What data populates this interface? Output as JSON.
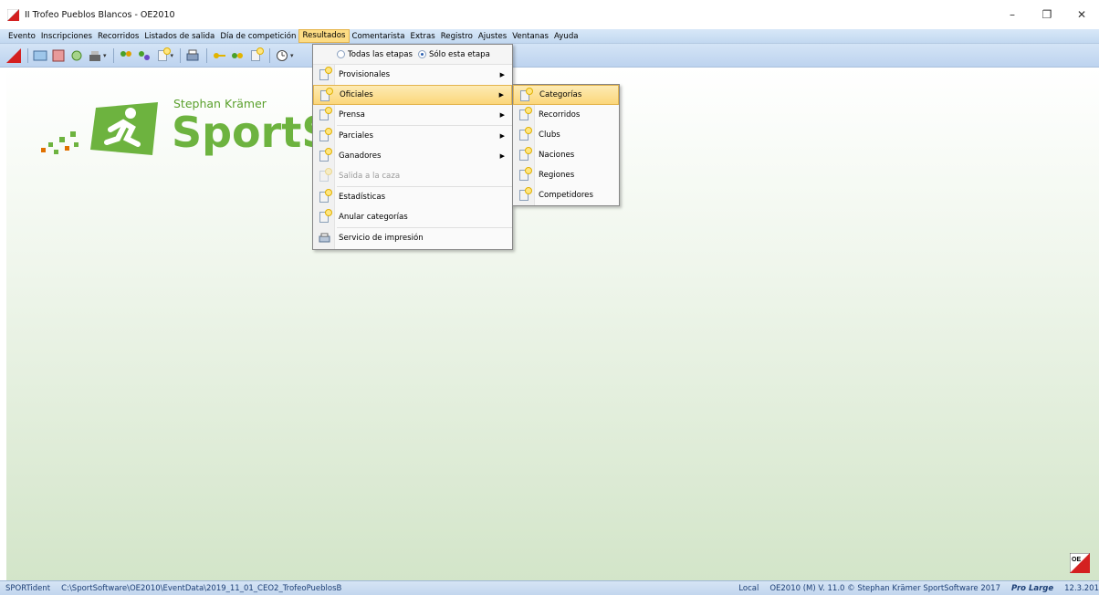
{
  "window": {
    "title": "II Trofeo Pueblos Blancos  -  OE2010",
    "minimize": "–",
    "restore": "❐",
    "close": "✕"
  },
  "menubar": {
    "items": [
      {
        "label": "Evento"
      },
      {
        "label": "Inscripciones"
      },
      {
        "label": "Recorridos"
      },
      {
        "label": "Listados de salida"
      },
      {
        "label": "Día de competición"
      },
      {
        "label": "Resultados"
      },
      {
        "label": "Comentarista"
      },
      {
        "label": "Extras"
      },
      {
        "label": "Registro"
      },
      {
        "label": "Ajustes"
      },
      {
        "label": "Ventanas"
      },
      {
        "label": "Ayuda"
      }
    ]
  },
  "resultados_menu": {
    "radio_all": "Todas las etapas",
    "radio_this": "Sólo esta etapa",
    "items": [
      {
        "label": "Provisionales",
        "icon": "document-icon"
      },
      {
        "label": "Oficiales",
        "icon": "document-icon"
      },
      {
        "label": "Prensa",
        "icon": "document-icon"
      },
      {
        "label": "Parciales",
        "icon": "document-icon"
      },
      {
        "label": "Ganadores",
        "icon": "document-icon"
      },
      {
        "label": "Salida a la caza",
        "icon": "document-icon"
      },
      {
        "label": "Estadísticas",
        "icon": "document-icon"
      },
      {
        "label": "Anular categorías",
        "icon": "document-icon"
      },
      {
        "label": "Servicio de impresión",
        "icon": "printer-icon"
      }
    ]
  },
  "oficiales_submenu": {
    "items": [
      {
        "label": "Categorías"
      },
      {
        "label": "Recorridos"
      },
      {
        "label": "Clubs"
      },
      {
        "label": "Naciones"
      },
      {
        "label": "Regiones"
      },
      {
        "label": "Competidores"
      }
    ]
  },
  "logo": {
    "sub": "Stephan Krämer",
    "main": "SportS"
  },
  "corner_logo": "OE",
  "statusbar": {
    "device": "SPORTident",
    "path": "C:\\SportSoftware\\OE2010\\EventData\\2019_11_01_CEO2_TrofeoPueblosB",
    "mode": "Local",
    "version": "OE2010 (M) V. 11.0 © Stephan Krämer SportSoftware 2017",
    "edition": "Pro Large",
    "date": "12.3.201"
  },
  "colors": {
    "accent": "#6db33f",
    "menu_highlight": "#fddc84",
    "status_text": "#1d3f75"
  }
}
